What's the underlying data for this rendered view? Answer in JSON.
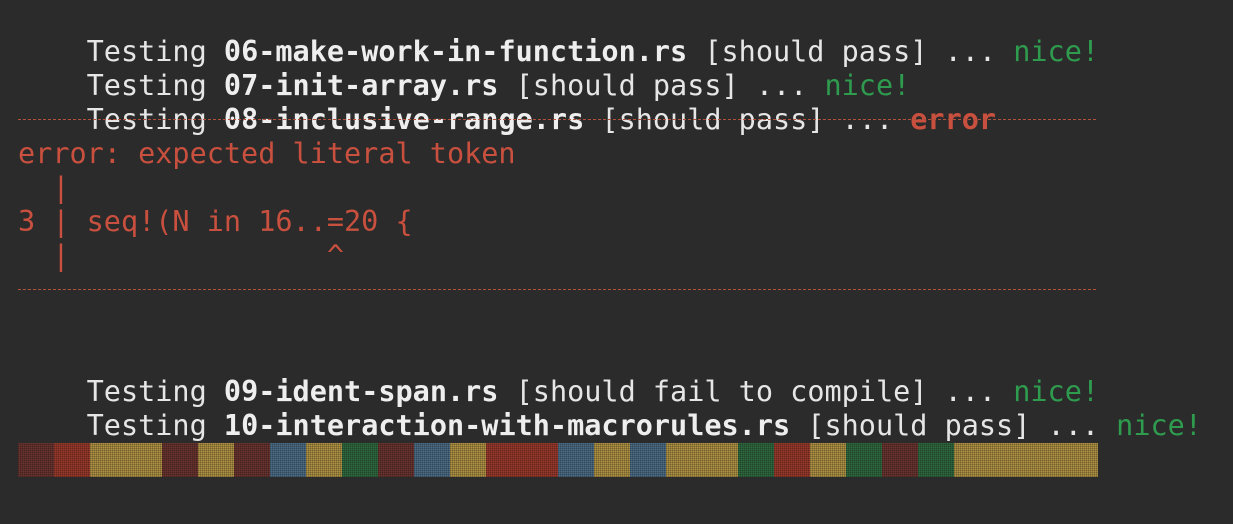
{
  "lines": [
    {
      "prefix": "Testing ",
      "file": "06-make-work-in-function.rs",
      "expect": " [should pass] ... ",
      "result": "nice!"
    },
    {
      "prefix": "Testing ",
      "file": "07-init-array.rs",
      "expect": " [should pass] ... ",
      "result": "nice!"
    },
    {
      "prefix": "Testing ",
      "file": "08-inclusive-range.rs",
      "expect": " [should pass] ... ",
      "result": "error"
    },
    {
      "prefix": "Testing ",
      "file": "09-ident-span.rs",
      "expect": " [should fail to compile] ... ",
      "result": "nice!"
    },
    {
      "prefix": "Testing ",
      "file": "10-interaction-with-macrorules.rs",
      "expect": " [should pass] ... ",
      "result": "nice!"
    }
  ],
  "error_block": {
    "message": "error: expected literal token",
    "gutter1": "  |",
    "code_line": "3 | seq!(N in 16..=20 {",
    "gutter2": "  |               ^"
  },
  "colors": {
    "background": "#2b2b2b",
    "ok": "#2e9b4e",
    "error": "#c9503e",
    "bar_dark_red": "#6a3530",
    "bar_red": "#9a3a2c",
    "bar_yellow": "#b09245",
    "bar_blue": "#4d6d86",
    "bar_green": "#2f6a3f"
  },
  "progress_bar_segments": [
    "#6a3530",
    "#9a3a2c",
    "#b09245",
    "#b09245",
    "#6a3530",
    "#b09245",
    "#6a3530",
    "#4d6d86",
    "#b09245",
    "#2f6a3f",
    "#6a3530",
    "#4d6d86",
    "#b09245",
    "#9a3a2c",
    "#9a3a2c",
    "#4d6d86",
    "#b09245",
    "#4d6d86",
    "#b09245",
    "#b09245",
    "#2f6a3f",
    "#9a3a2c",
    "#b09245",
    "#2f6a3f",
    "#6a3530",
    "#2f6a3f",
    "#b09245",
    "#b09245",
    "#b09245",
    "#b09245"
  ]
}
